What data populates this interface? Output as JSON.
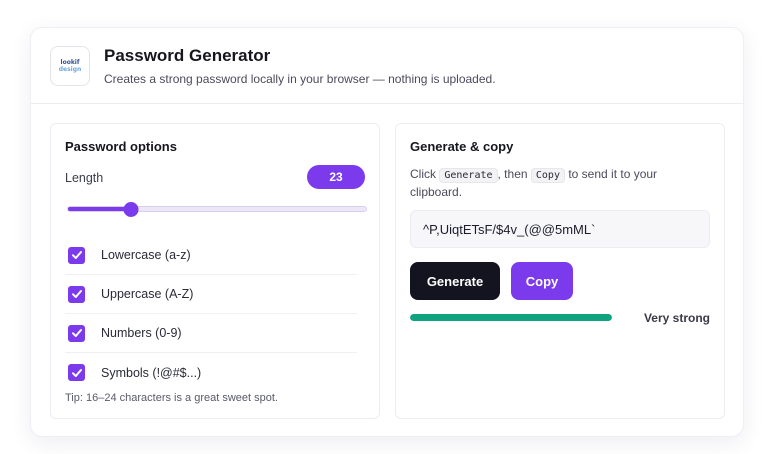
{
  "header": {
    "logo_line1": "lookif",
    "logo_line2": "design",
    "title": "Password Generator",
    "subtitle": "Creates a strong password locally in your browser — nothing is uploaded."
  },
  "options": {
    "title": "Password options",
    "length_label": "Length",
    "length_value": "23",
    "slider_fraction": 0.21,
    "items": [
      {
        "label": "Lowercase (a-z)",
        "checked": true
      },
      {
        "label": "Uppercase (A-Z)",
        "checked": true
      },
      {
        "label": "Numbers (0-9)",
        "checked": true
      },
      {
        "label": "Symbols (!@#$...)",
        "checked": true
      }
    ],
    "tip": "Tip: 16–24 characters is a great sweet spot."
  },
  "generate": {
    "title": "Generate & copy",
    "desc_click": "Click",
    "desc_generate_code": "Generate",
    "desc_then": ", then",
    "desc_copy_code": "Copy",
    "desc_rest": "to send it to your clipboard.",
    "password": "^P,UiqtETsF/$4v_(@@5mML`",
    "generate_label": "Generate",
    "copy_label": "Copy",
    "strength_fraction": 1.0,
    "strength_label": "Very strong"
  },
  "colors": {
    "accent": "#7c3aed",
    "dark_button": "#141421",
    "strength": "#10a37f"
  }
}
